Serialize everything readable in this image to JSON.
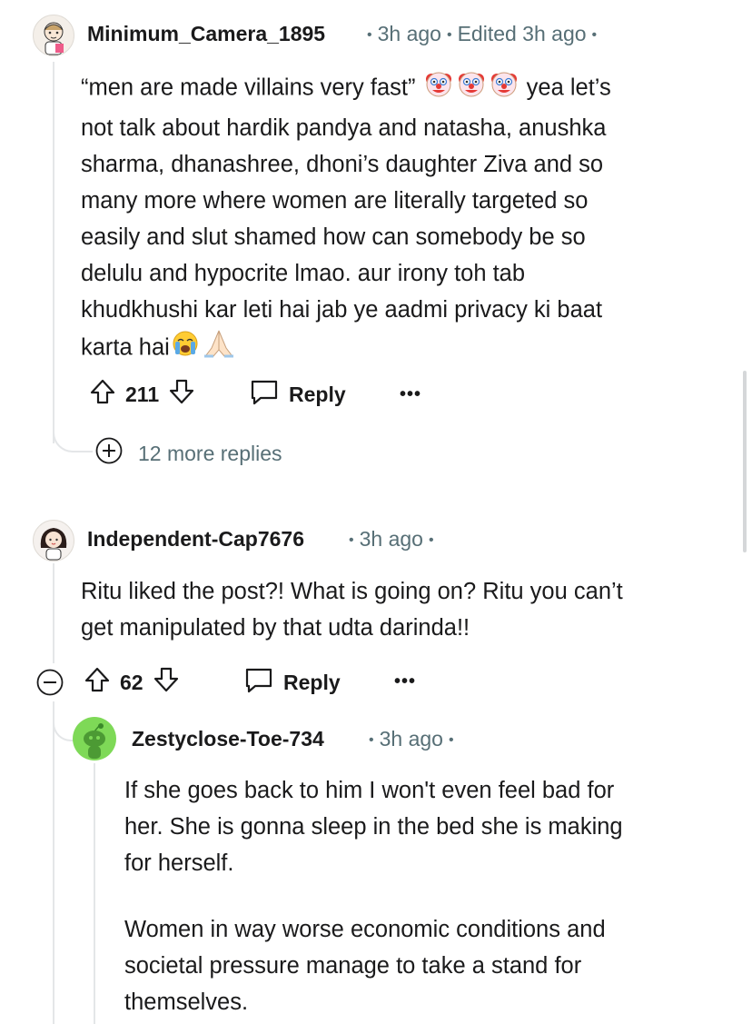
{
  "comments": [
    {
      "username": "Minimum_Camera_1895",
      "time": "3h ago",
      "edited": "Edited 3h ago",
      "body_line1_a": "“men are made villains very fast”",
      "body_line1_b": "yea let’s",
      "body_lines": [
        "not talk about hardik pandya and natasha, anushka",
        "sharma, dhanashree, dhoni’s daughter Ziva and so",
        "many more where women are literally targeted so",
        "easily and slut shamed how can somebody be so",
        "delulu and hypocrite lmao. aur irony toh tab",
        "khudkhushi kar leti hai jab ye aadmi privacy ki baat"
      ],
      "body_last": "karta hai",
      "votes": "211",
      "reply_label": "Reply",
      "more_label": "•••",
      "more_replies": "12 more replies"
    },
    {
      "username": "Independent-Cap7676",
      "time": "3h ago",
      "body_lines": [
        "Ritu liked the post?! What is going on? Ritu you can’t",
        "get manipulated by that udta darinda!!"
      ],
      "votes": "62",
      "reply_label": "Reply",
      "more_label": "•••"
    },
    {
      "username": "Zestyclose-Toe-734",
      "time": "3h ago",
      "body_para1": [
        "If she goes back to him I won't even feel bad for",
        "her. She is gonna sleep in the bed she is making",
        "for herself."
      ],
      "body_para2": [
        "Women in way worse economic conditions and",
        "societal pressure manage to take a stand for",
        "themselves."
      ]
    }
  ],
  "icons": {
    "upvote": "arrow-up-icon",
    "downvote": "arrow-down-icon",
    "reply": "speech-bubble-icon",
    "expand": "plus-circle-icon",
    "collapse": "minus-circle-icon",
    "clown_emoji": "clown-face-icon",
    "crying_emoji": "loudly-crying-face-icon",
    "pray_emoji": "folded-hands-icon"
  },
  "colors": {
    "text": "#1a1a1b",
    "meta": "#576f76",
    "thread_line": "#e4e6e8",
    "avatar_green": "#7ed957"
  }
}
